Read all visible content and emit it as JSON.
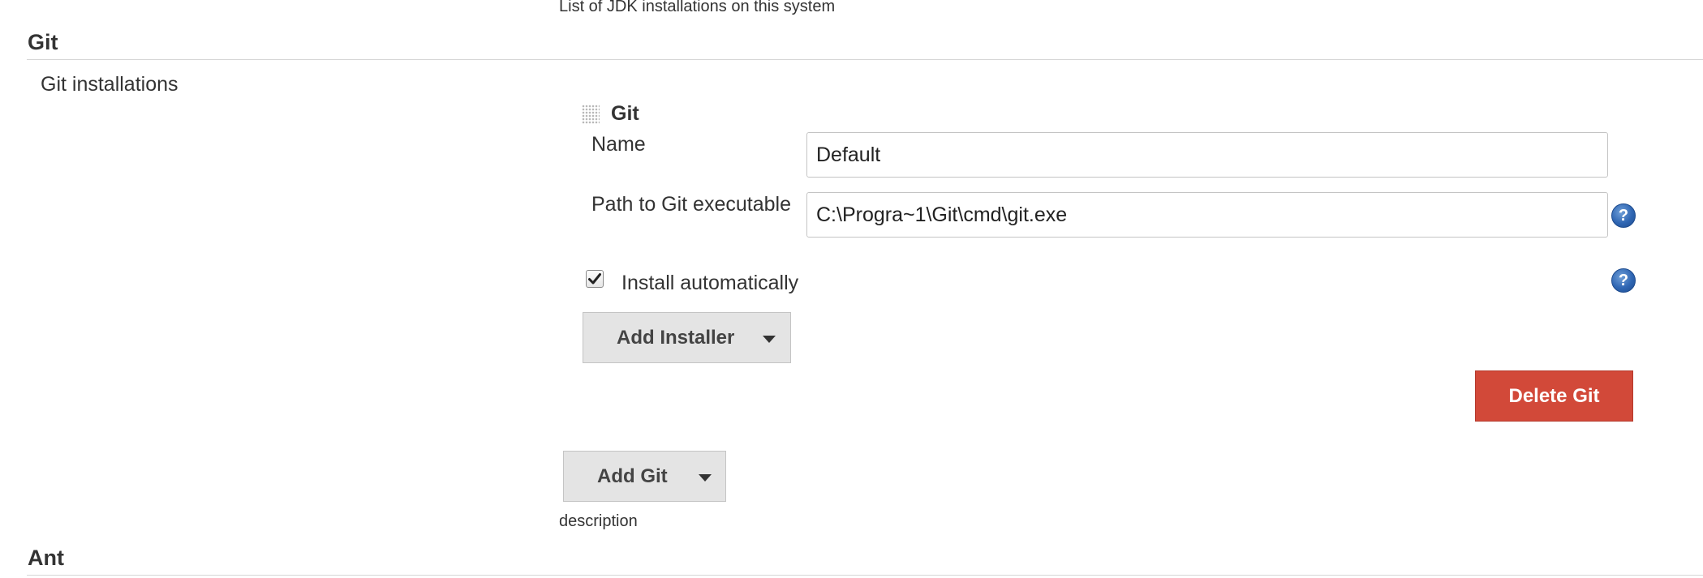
{
  "jdk": {
    "description": "List of JDK installations on this system"
  },
  "git_section": {
    "title": "Git",
    "installations_label": "Git installations",
    "item": {
      "header": "Git",
      "name_label": "Name",
      "name_value": "Default",
      "path_label": "Path to Git executable",
      "path_value": "C:\\Progra~1\\Git\\cmd\\git.exe",
      "install_auto_label": "Install automatically",
      "install_auto_checked": true,
      "add_installer_label": "Add Installer",
      "delete_label": "Delete Git"
    },
    "add_git_label": "Add Git",
    "description": "description"
  },
  "ant_section": {
    "title": "Ant"
  },
  "colors": {
    "delete_button": "#d24939",
    "help_icon": "#2f66b3",
    "button_gray": "#e4e4e4"
  },
  "icons": {
    "drag": "drag-handle-icon",
    "help": "help-icon",
    "dropdown": "caret-down-icon",
    "check": "checkmark-icon"
  }
}
